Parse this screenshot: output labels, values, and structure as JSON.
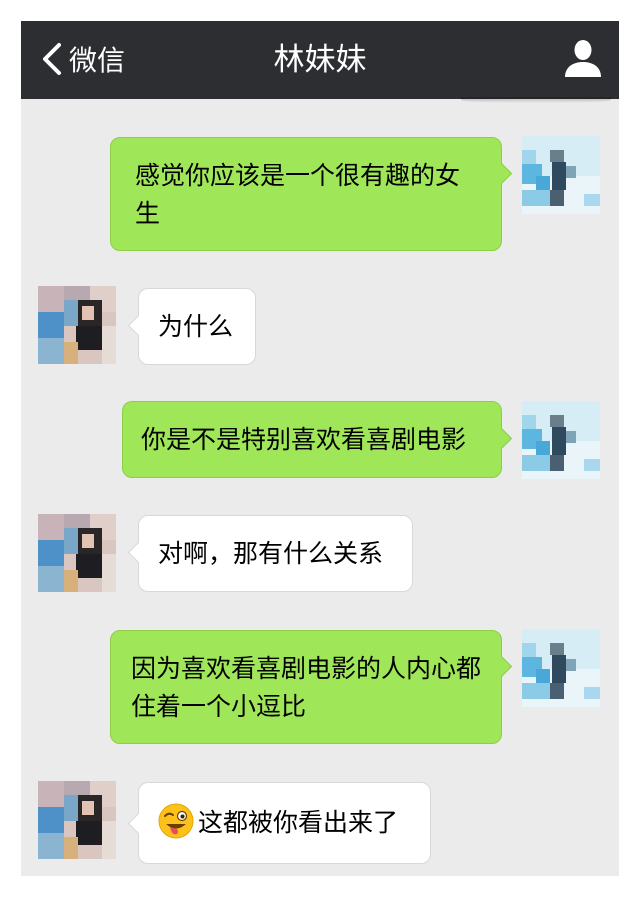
{
  "header": {
    "back_label": "微信",
    "title": "林妹妹"
  },
  "messages": [
    {
      "side": "sent",
      "text": "感觉你应该是一个很有趣的女生"
    },
    {
      "side": "received",
      "text": "为什么"
    },
    {
      "side": "sent",
      "text": "你是不是特别喜欢看喜剧电影"
    },
    {
      "side": "received",
      "text": "对啊，那有什么关系"
    },
    {
      "side": "sent",
      "text": "因为喜欢看喜剧电影的人内心都住着一个小逗比"
    },
    {
      "side": "received",
      "text": "这都被你看出来了",
      "emoji": "winking-tongue-emoji"
    }
  ],
  "icons": {
    "back": "chevron-left-icon",
    "profile": "person-icon"
  },
  "colors": {
    "navbar": "#2d2e32",
    "background": "#ebebeb",
    "sent_bubble": "#9fe658",
    "received_bubble": "#ffffff"
  }
}
